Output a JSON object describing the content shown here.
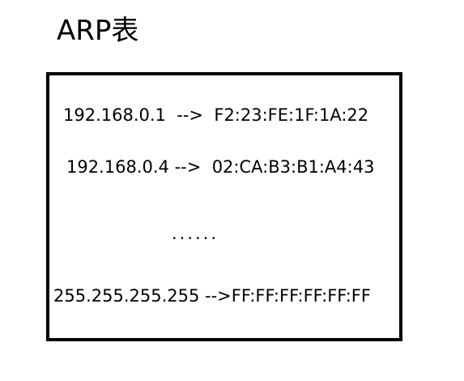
{
  "title": "ARP表",
  "entries": [
    {
      "text": "192.168.0.1  -->  F2:23:FE:1F:1A:22"
    },
    {
      "text": "192.168.0.4 -->  02:CA:B3:B1:A4:43"
    }
  ],
  "ellipsis": "......",
  "last_entry": {
    "text": "255.255.255.255 -->FF:FF:FF:FF:FF:FF"
  }
}
